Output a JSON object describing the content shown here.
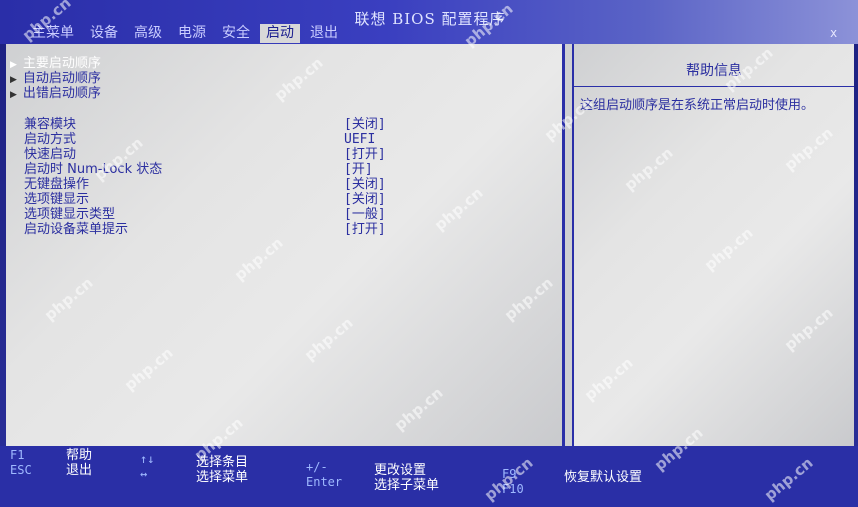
{
  "window": {
    "title": "联想 BIOS 配置程序"
  },
  "tabs": [
    {
      "label": "主菜单",
      "active": false
    },
    {
      "label": "设备",
      "active": false
    },
    {
      "label": "高级",
      "active": false
    },
    {
      "label": "电源",
      "active": false
    },
    {
      "label": "安全",
      "active": false
    },
    {
      "label": "启动",
      "active": true
    },
    {
      "label": "退出",
      "active": false
    }
  ],
  "corner_mark": "x",
  "boot_menus": [
    {
      "label": "主要启动顺序",
      "selected": true
    },
    {
      "label": "自动启动顺序",
      "selected": false
    },
    {
      "label": "出错启动顺序",
      "selected": false
    }
  ],
  "settings": [
    {
      "label": "兼容模块",
      "value": "[关闭]"
    },
    {
      "label": "启动方式",
      "value": "UEFI"
    },
    {
      "label": "快速启动",
      "value": "[打开]"
    },
    {
      "label": "启动时 Num-Lock 状态",
      "value": "[开]"
    },
    {
      "label": "无键盘操作",
      "value": "[关闭]"
    },
    {
      "label": "选项键显示",
      "value": "[关闭]"
    },
    {
      "label": "选项键显示类型",
      "value": "[一般]"
    },
    {
      "label": "启动设备菜单提示",
      "value": "[打开]"
    }
  ],
  "help": {
    "title": "帮助信息",
    "text": "这组启动顺序是在系统正常启动时使用。"
  },
  "footer": {
    "keys": [
      {
        "key": "F1",
        "desc": "帮助"
      },
      {
        "key": "ESC",
        "desc": "退出"
      },
      {
        "key": "↑↓",
        "desc": "选择条目"
      },
      {
        "key": "↔",
        "desc": "选择菜单"
      },
      {
        "key": "+/-",
        "desc": "更改设置"
      },
      {
        "key": "Enter",
        "desc": "选择子菜单"
      },
      {
        "key": "F9",
        "desc": "恢复默认设置"
      },
      {
        "key": "F10",
        "desc": ""
      }
    ]
  },
  "watermark": {
    "text": "php.cn"
  },
  "colors": {
    "header": "#2a2ea8",
    "panel": "#e4e4e4",
    "text": "#2b2fa0",
    "footer": "#2a2fa6"
  }
}
